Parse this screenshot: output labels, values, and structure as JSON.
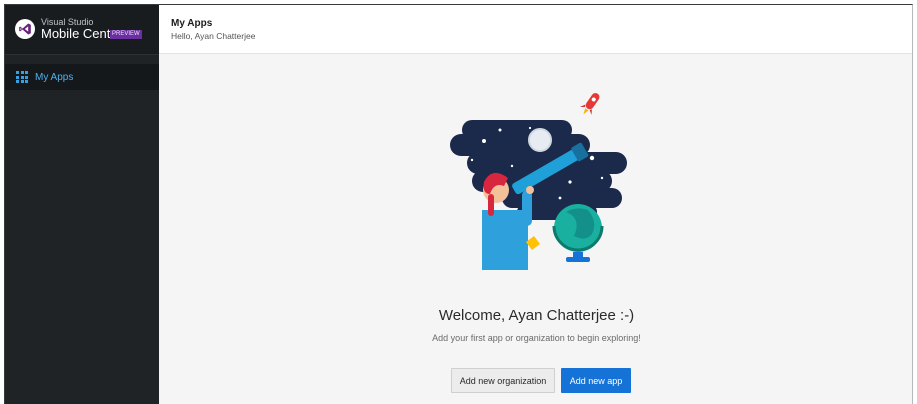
{
  "brand": {
    "line1": "Visual Studio",
    "line2": "Mobile Center",
    "badge": "PREVIEW",
    "logo_icon": "visual-studio-logo-icon",
    "logo_color": "#68217a"
  },
  "sidebar": {
    "items": [
      {
        "label": "My Apps",
        "icon": "apps-grid-icon",
        "active": true
      }
    ]
  },
  "header": {
    "title": "My Apps",
    "subtitle": "Hello, Ayan Chatterjee"
  },
  "main": {
    "illustration": "telescope-stargazer-illustration",
    "welcome": "Welcome, Ayan Chatterjee :-)",
    "tagline": "Add your first app or organization to begin exploring!",
    "buttons": {
      "add_org": "Add new organization",
      "add_app": "Add new app"
    }
  },
  "colors": {
    "sidebar": "#1f2326",
    "accent": "#1572d6",
    "nav_active": "#4fb0ef",
    "badge": "#6b2fa0",
    "main_bg": "#f5f5f5"
  }
}
